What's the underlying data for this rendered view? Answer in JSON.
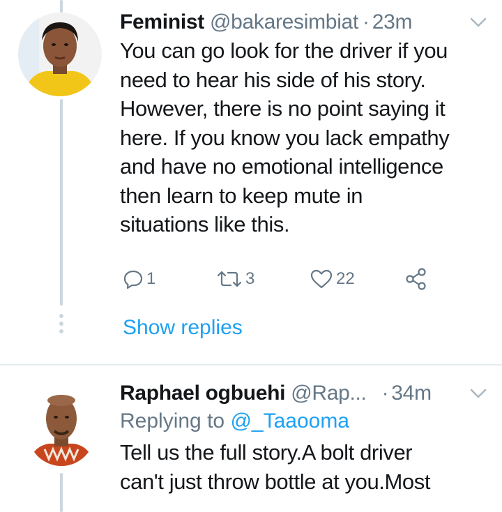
{
  "tweet1": {
    "name": "Feminist",
    "handle": "@bakaresimbiat",
    "separator": "·",
    "time": "23m",
    "text_lines": [
      "You can go look for the driver if you",
      "need to hear his side of his story.",
      "However, there is no point saying it",
      "here. If you know you lack empathy",
      "and have no emotional intelligence",
      "then learn to keep mute in",
      "situations like this."
    ],
    "actions": {
      "reply_count": "1",
      "retweet_count": "3",
      "like_count": "22"
    },
    "show_replies": "Show replies"
  },
  "tweet2": {
    "name": "Raphael ogbuehi",
    "handle": "@Rap...",
    "separator": "·",
    "time": "34m",
    "replying_prefix": "Replying to",
    "replying_handle": "@_Taaooma",
    "text_lines": [
      "Tell us the full story.A bolt driver",
      "can't just throw bottle at you.Most"
    ]
  },
  "colors": {
    "link_blue": "#1da1f2",
    "meta_gray": "#657786",
    "thread_line": "#ccd6dd",
    "divider": "#e6ecf0"
  },
  "icons": [
    "reply-icon",
    "retweet-icon",
    "like-icon",
    "share-icon",
    "chevron-down-icon"
  ]
}
